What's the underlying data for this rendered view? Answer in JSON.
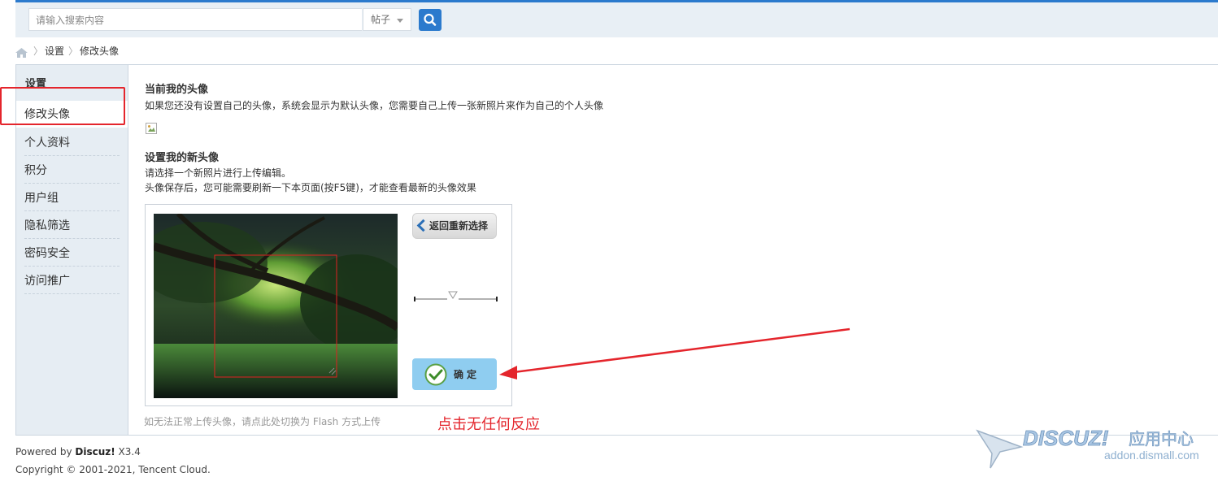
{
  "search": {
    "placeholder": "请输入搜索内容",
    "type_selected": "帖子",
    "button_icon": "search-icon"
  },
  "breadcrumb": {
    "home_icon": "home-icon",
    "separator": "〉",
    "items": [
      "设置",
      "修改头像"
    ]
  },
  "sidebar": {
    "title": "设置",
    "items": [
      {
        "label": "修改头像",
        "active": true
      },
      {
        "label": "个人资料"
      },
      {
        "label": "积分"
      },
      {
        "label": "用户组"
      },
      {
        "label": "隐私筛选"
      },
      {
        "label": "密码安全"
      },
      {
        "label": "访问推广"
      }
    ]
  },
  "main": {
    "current_avatar_title": "当前我的头像",
    "current_avatar_desc": "如果您还没有设置自己的头像，系统会显示为默认头像，您需要自己上传一张新照片来作为自己的个人头像",
    "new_avatar_title": "设置我的新头像",
    "new_avatar_desc1": "请选择一个新照片进行上传编辑。",
    "new_avatar_desc2": "头像保存后，您可能需要刷新一下本页面(按F5键)，才能查看最新的头像效果",
    "back_button": "返回重新选择",
    "confirm_button": "确定",
    "flash_hint": "如无法正常上传头像，请点此处切换为 Flash 方式上传"
  },
  "annotation": "点击无任何反应",
  "footer": {
    "powered_prefix": "Powered by ",
    "powered_brand": "Discuz!",
    "powered_version": " X3.4",
    "copyright": "Copyright © 2001-2021, Tencent Cloud."
  },
  "watermark": {
    "brand": "DISCUZ!",
    "suffix": "应用中心",
    "domain": "addon.dismall.com"
  },
  "colors": {
    "accent": "#2b7acd",
    "annotation_red": "#e4252c",
    "confirm_bg": "#8fcdf0",
    "sidebar_bg": "#e6edf3"
  }
}
